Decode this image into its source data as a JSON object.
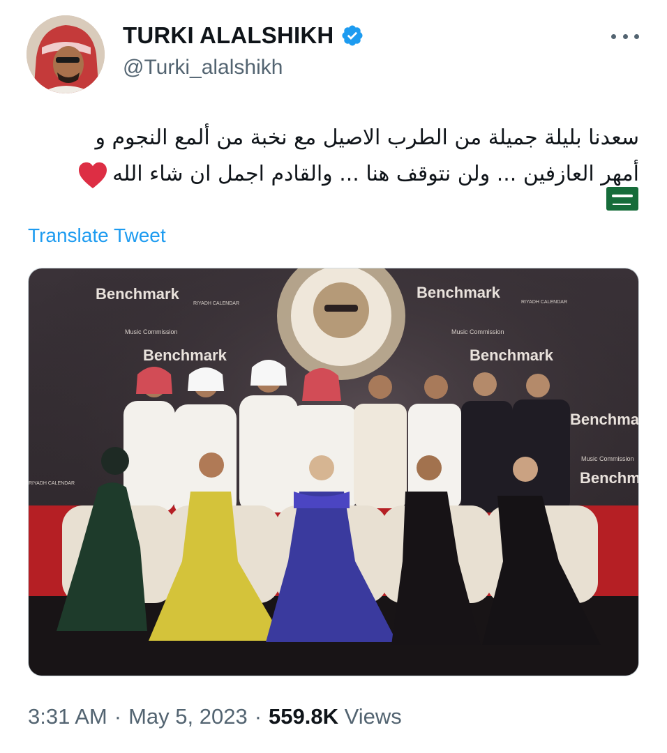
{
  "tweet": {
    "author": {
      "display_name": "TURKI ALALSHIKH",
      "handle": "@Turki_alalshikh",
      "verified": true,
      "avatar_icon": "profile-photo-avatar"
    },
    "text_lines": [
      "سعدنا بليلة جميلة من الطرب الاصيل مع نخبة من ألمع النجوم و",
      "أمهر العازفين ... ولن نتوقف هنا ... والقادم اجمل ان شاء الله"
    ],
    "emoji": [
      "red-heart-icon",
      "saudi-flag-icon"
    ],
    "translate_label": "Translate Tweet",
    "media": {
      "banner_text": "Benchmark",
      "sponsor_text": "Music Commission",
      "calendar_text": "RIYADH CALENDAR"
    },
    "time": "3:31 AM",
    "separator": "·",
    "date": "May 5, 2023",
    "views_count": "559.8K",
    "views_label": "Views"
  },
  "colors": {
    "accent": "#1d9bf0",
    "secondary_text": "#536471",
    "primary_text": "#0f1419"
  }
}
